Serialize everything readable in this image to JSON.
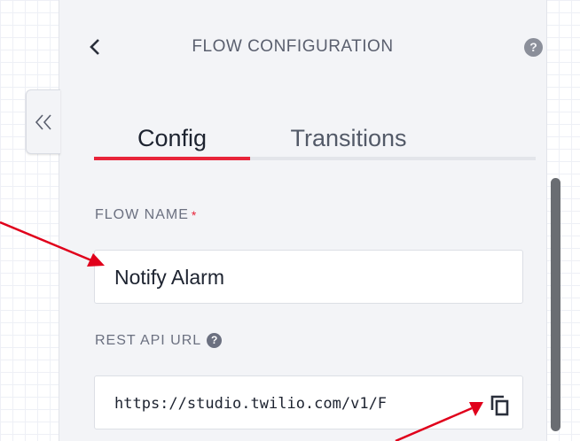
{
  "header": {
    "title": "FLOW CONFIGURATION",
    "back_icon": "chevron-left",
    "help_icon": "question-circle",
    "help_glyph": "?"
  },
  "sidebar_toggle": {
    "icon": "double-chevron-left"
  },
  "tabs": [
    {
      "label": "Config",
      "active": true
    },
    {
      "label": "Transitions",
      "active": false
    }
  ],
  "fields": {
    "flow_name": {
      "label": "FLOW NAME",
      "required_mark": "*",
      "value": "Notify Alarm"
    },
    "rest_api_url": {
      "label": "REST API URL",
      "info_glyph": "?",
      "value": "https://studio.twilio.com/v1/F",
      "copy_icon": "copy"
    }
  },
  "colors": {
    "accent": "#e8243a",
    "annotation": "#e0001b"
  }
}
